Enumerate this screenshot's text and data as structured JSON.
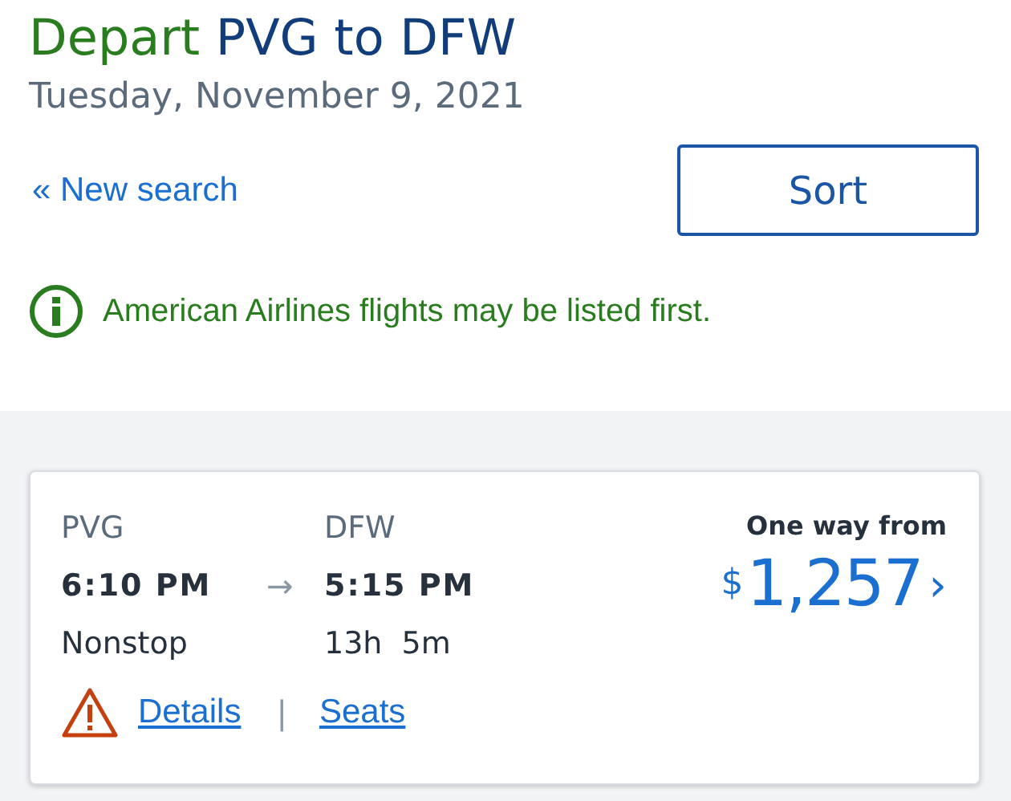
{
  "header": {
    "depart_label": "Depart",
    "route": "PVG to DFW",
    "date": "Tuesday, November 9, 2021"
  },
  "new_search_link": "« New search",
  "sort_button": "Sort",
  "notice": "American Airlines flights may be listed first.",
  "flight": {
    "origin": "PVG",
    "destination": "DFW",
    "depart_time": "6:10 PM",
    "arrow": "→",
    "arrive_time": "5:15 PM",
    "stops": "Nonstop",
    "duration": "13h  5m",
    "price_label": "One way from",
    "currency": "$",
    "price": "1,257",
    "chevron": "›",
    "details_link": "Details",
    "separator": "|",
    "seats_link": "Seats",
    "warning": true
  }
}
